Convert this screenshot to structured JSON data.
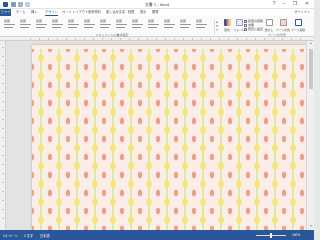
{
  "window": {
    "title": "文書 1 - Word",
    "help_label": "?",
    "minimize_label": "–",
    "restore_label": "❐",
    "close_label": "✕"
  },
  "tabs": {
    "file": "ファイル",
    "items": [
      "ホーム",
      "挿入",
      "デザイン",
      "ページ レイアウト",
      "参考資料",
      "差し込み文書",
      "校閲",
      "表示",
      "開発"
    ],
    "active": "デザイン",
    "user": "サインイン"
  },
  "ribbon": {
    "styles": [
      "表題",
      "表題",
      "表題",
      "表題",
      "表題",
      "表題",
      "表題",
      "表題",
      "表題",
      "表題",
      "表題",
      "表題",
      "表題"
    ],
    "section_label": "ドキュメントの書式設定",
    "buttons": {
      "colors": "配色",
      "fonts": "フォント",
      "watermark": "透かし",
      "page_color": "ページの色",
      "page_borders": "ページ罫線"
    },
    "checks": [
      "段落の間隔",
      "効果",
      "既定に設定"
    ],
    "page_bg_label": "ページの背景",
    "colors": {
      "accent": "#2b579a",
      "page_pink": "#ef9f8e",
      "page_yellow": "#f3e57a"
    }
  },
  "statusbar": {
    "page": "1/1 ページ",
    "words": "0 文字",
    "lang": "日本語",
    "zoom": "100%"
  },
  "icons": {
    "save": "save-icon",
    "undo": "undo-icon",
    "redo": "redo-icon",
    "scroll_up": "▲",
    "scroll_down": "▼",
    "gallery_up": "▲",
    "gallery_down": "▼",
    "gallery_more": "▾"
  }
}
